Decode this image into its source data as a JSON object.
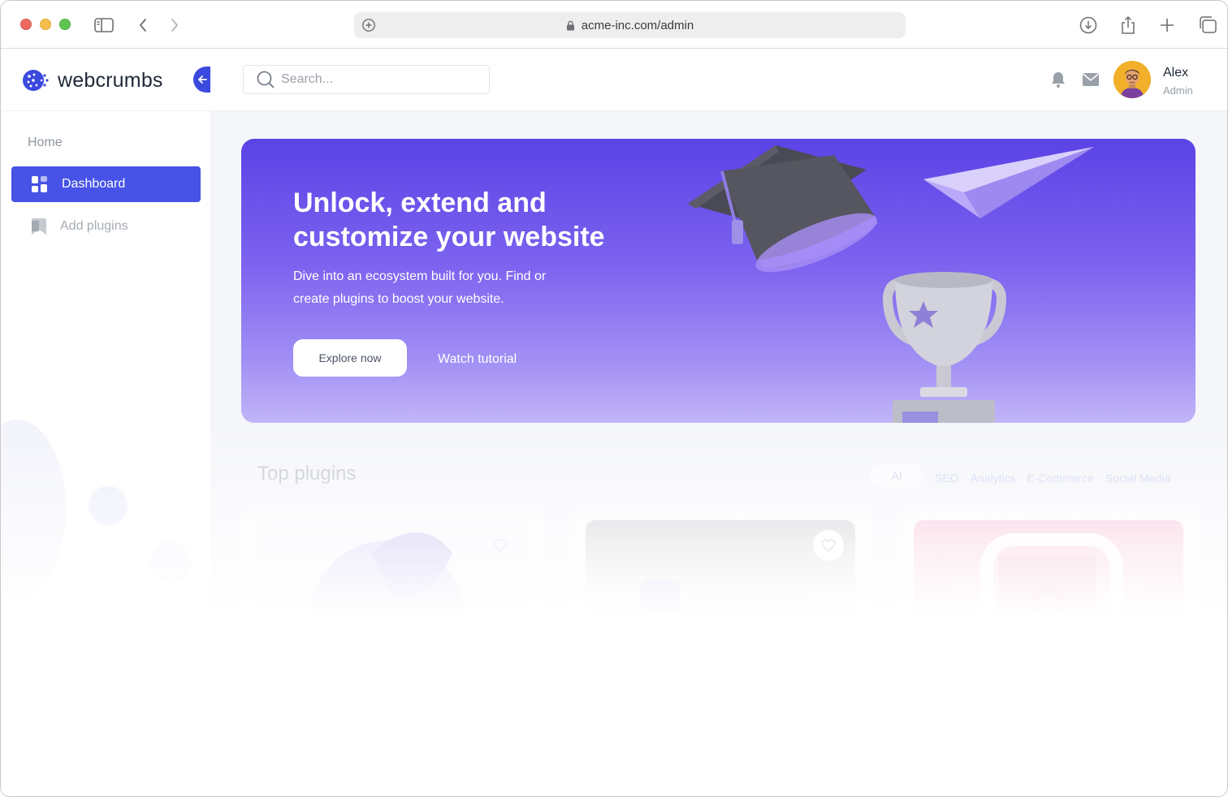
{
  "browser": {
    "url": "acme-inc.com/admin"
  },
  "header": {
    "brand": "webcrumbs",
    "search_placeholder": "Search...",
    "user_name": "Alex",
    "user_role": "Admin"
  },
  "sidebar": {
    "section": "Home",
    "items": [
      {
        "label": "Dashboard",
        "icon": "grid-icon",
        "active": true
      },
      {
        "label": "Add plugins",
        "icon": "bookmark-icon",
        "active": false
      }
    ]
  },
  "hero": {
    "title": "Unlock, extend and customize your website",
    "subtitle": "Dive into an ecosystem built for you. Find or create plugins to boost your website.",
    "primary_button": "Explore now",
    "secondary_link": "Watch tutorial"
  },
  "plugins": {
    "title": "Top plugins",
    "filters": [
      "AI",
      "SEO",
      "Analytics",
      "E-Commerce",
      "Social Media"
    ],
    "cards": [
      {
        "label": ""
      },
      {
        "label": "Writesonic"
      },
      {
        "label": ""
      }
    ]
  },
  "colors": {
    "accent": "#4653e6",
    "hero_top": "#5b43e6",
    "hero_bottom": "#c2b5f8"
  }
}
